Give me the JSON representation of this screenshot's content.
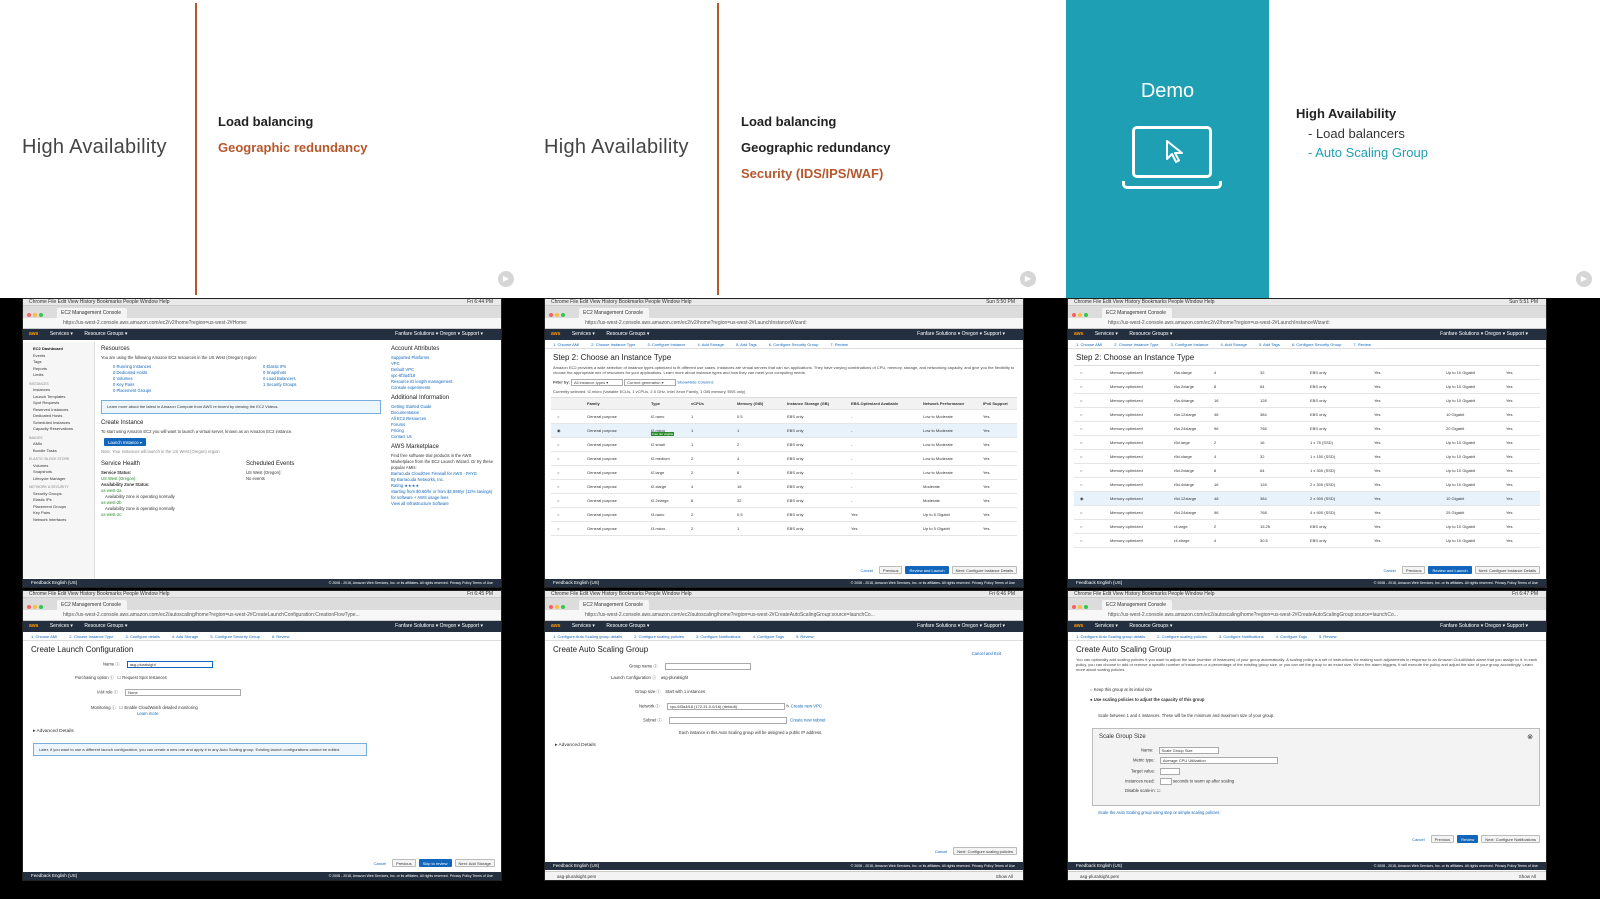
{
  "slides": {
    "s1": {
      "title": "High Availability",
      "bullets": [
        "Load balancing",
        "Geographic redundancy"
      ]
    },
    "s2": {
      "title": "High Availability",
      "bullets": [
        "Load balancing",
        "Geographic redundancy",
        "Security (IDS/IPS/WAF)"
      ]
    },
    "s3": {
      "demo_label": "Demo",
      "title": "High Availability",
      "items": [
        "- Load balancers",
        "- Auto Scaling Group"
      ]
    }
  },
  "colors": {
    "accent_orange": "#b5582d",
    "demo_teal": "#1f9fb3",
    "aws_nav": "#232f3e",
    "aws_orange": "#ff9900",
    "primary_blue": "#1166bb"
  },
  "browser": {
    "mac_menu": "Chrome  File  Edit  View  History  Bookmarks  People  Window  Help",
    "tab_title": "EC2 Management Console",
    "aws_logo": "aws",
    "nav_services": "Services ▾",
    "nav_resource_groups": "Resource Groups ▾",
    "nav_right": "Fanfare Solutions ▾   Oregon ▾   Support ▾",
    "footer": "Feedback   English (US)",
    "copyright": "© 2008 - 2018, Amazon Web Services, Inc. or its affiliates. All rights reserved.   Privacy Policy   Terms of Use"
  },
  "shot1": {
    "time": "Fri 6:44 PM",
    "url": "https://us-west-2.console.aws.amazon.com/ec2/v2/home?region=us-west-2#Home:",
    "sidebar": [
      "EC2 Dashboard",
      "Events",
      "Tags",
      "Reports",
      "Limits",
      "INSTANCES",
      "Instances",
      "Launch Templates",
      "Spot Requests",
      "Reserved Instances",
      "Dedicated Hosts",
      "Scheduled Instances",
      "Capacity Reservations",
      "IMAGES",
      "AMIs",
      "Bundle Tasks",
      "ELASTIC BLOCK STORE",
      "Volumes",
      "Snapshots",
      "Lifecycle Manager",
      "NETWORK & SECURITY",
      "Security Groups",
      "Elastic IPs",
      "Placement Groups",
      "Key Pairs",
      "Network Interfaces"
    ],
    "resources_title": "Resources",
    "resources_intro": "You are using the following Amazon EC2 resources in the US West (Oregon) region:",
    "resources_left": [
      "0 Running Instances",
      "0 Dedicated Hosts",
      "0 Volumes",
      "0 Key Pairs",
      "0 Placement Groups"
    ],
    "resources_right": [
      "0 Elastic IPs",
      "0 Snapshots",
      "0 Load Balancers",
      "1 Security Groups"
    ],
    "info_banner": "Learn more about the latest in Amazon Compute from AWS re:Invent by viewing the EC2 Videos.",
    "create_instance_title": "Create Instance",
    "create_instance_text": "To start using Amazon EC2 you will want to launch a virtual server, known as an Amazon EC2 instance.",
    "launch_button": "Launch Instance ▾",
    "launch_note": "Note: Your instances will launch in the US West (Oregon) region",
    "service_health_title": "Service Health",
    "service_status_label": "Service Status:",
    "service_status_value": "US West (Oregon):",
    "az_status_label": "Availability Zone Status:",
    "az_items": [
      "us-west-2a",
      "Availability zone is operating normally",
      "us-west-2b",
      "Availability zone is operating normally",
      "us-west-2c"
    ],
    "scheduled_title": "Scheduled Events",
    "scheduled_region": "US West (Oregon):",
    "scheduled_value": "No events",
    "account_title": "Account Attributes",
    "account_items": [
      "Supported Platforms",
      "VPC",
      "Default VPC",
      "vpc-6f3a4f18",
      "Resource ID length management",
      "Console experiments"
    ],
    "additional_title": "Additional Information",
    "additional_items": [
      "Getting Started Guide",
      "Documentation",
      "All EC2 Resources",
      "Forums",
      "Pricing",
      "Contact Us"
    ],
    "marketplace_title": "AWS Marketplace",
    "marketplace_text": "Find free software trial products in the AWS Marketplace from the EC2 Launch Wizard. Or try these popular AMIs:",
    "marketplace_items": [
      "Barracuda CloudGen Firewall for AWS - PAYG",
      "By Barracuda Networks, Inc.",
      "Rating ★★★★",
      "Starting from $0.60/hr or from $4,599/yr (12% savings) for software + AWS usage fees",
      "View all Infrastructure Software"
    ]
  },
  "shot2": {
    "time": "Sun 5:50 PM",
    "url": "https://us-west-2.console.aws.amazon.com/ec2/v2/home?region=us-west-2#LaunchInstanceWizard:",
    "steps": [
      "1. Choose AMI",
      "2. Choose Instance Type",
      "3. Configure Instance",
      "4. Add Storage",
      "5. Add Tags",
      "6. Configure Security Group",
      "7. Review"
    ],
    "title": "Step 2: Choose an Instance Type",
    "description": "Amazon EC2 provides a wide selection of instance types optimized to fit different use cases. Instances are virtual servers that can run applications. They have varying combinations of CPU, memory, storage, and networking capacity, and give you the flexibility to choose the appropriate mix of resources for your applications. Learn more about instance types and how they can meet your computing needs.",
    "filter_label": "Filter by:",
    "filter_value": "All instance types ▾",
    "generation_value": "Current generation ▾",
    "show_hide": "Show/Hide Columns",
    "currently_selected": "Currently selected: t2.micro (Variable ECUs, 1 vCPUs, 2.5 GHz, Intel Xeon Family, 1 GiB memory, EBS only)",
    "columns": [
      "Family",
      "Type",
      "vCPUs",
      "Memory (GiB)",
      "Instance Storage (GB)",
      "EBS-Optimized Available",
      "Network Performance",
      "IPv6 Support"
    ],
    "rows": [
      [
        "General purpose",
        "t2.nano",
        "1",
        "0.5",
        "EBS only",
        "-",
        "Low to Moderate",
        "Yes"
      ],
      [
        "General purpose",
        "t2.micro",
        "1",
        "1",
        "EBS only",
        "-",
        "Low to Moderate",
        "Yes"
      ],
      [
        "General purpose",
        "t2.small",
        "1",
        "2",
        "EBS only",
        "-",
        "Low to Moderate",
        "Yes"
      ],
      [
        "General purpose",
        "t2.medium",
        "2",
        "4",
        "EBS only",
        "-",
        "Low to Moderate",
        "Yes"
      ],
      [
        "General purpose",
        "t2.large",
        "2",
        "8",
        "EBS only",
        "-",
        "Low to Moderate",
        "Yes"
      ],
      [
        "General purpose",
        "t2.xlarge",
        "4",
        "16",
        "EBS only",
        "-",
        "Moderate",
        "Yes"
      ],
      [
        "General purpose",
        "t2.2xlarge",
        "8",
        "32",
        "EBS only",
        "-",
        "Moderate",
        "Yes"
      ],
      [
        "General purpose",
        "t3.nano",
        "2",
        "0.5",
        "EBS only",
        "Yes",
        "Up to 5 Gigabit",
        "Yes"
      ],
      [
        "General purpose",
        "t3.micro",
        "2",
        "1",
        "EBS only",
        "Yes",
        "Up to 5 Gigabit",
        "Yes"
      ]
    ],
    "free_tier_badge": "Free tier eligible",
    "buttons": [
      "Cancel",
      "Previous",
      "Review and Launch",
      "Next: Configure Instance Details"
    ]
  },
  "shot3": {
    "time": "Sun 5:51 PM",
    "title": "Step 2: Choose an Instance Type",
    "rows": [
      [
        "Memory optimized",
        "r5a.xlarge",
        "4",
        "32",
        "EBS only",
        "Yes",
        "Up to 10 Gigabit",
        "Yes"
      ],
      [
        "Memory optimized",
        "r5a.2xlarge",
        "8",
        "64",
        "EBS only",
        "Yes",
        "Up to 10 Gigabit",
        "Yes"
      ],
      [
        "Memory optimized",
        "r5a.4xlarge",
        "16",
        "128",
        "EBS only",
        "Yes",
        "Up to 10 Gigabit",
        "Yes"
      ],
      [
        "Memory optimized",
        "r5a.12xlarge",
        "48",
        "384",
        "EBS only",
        "Yes",
        "10 Gigabit",
        "Yes"
      ],
      [
        "Memory optimized",
        "r5a.24xlarge",
        "96",
        "768",
        "EBS only",
        "Yes",
        "20 Gigabit",
        "Yes"
      ],
      [
        "Memory optimized",
        "r5d.large",
        "2",
        "16",
        "1 x 75 (SSD)",
        "Yes",
        "Up to 10 Gigabit",
        "Yes"
      ],
      [
        "Memory optimized",
        "r5d.xlarge",
        "4",
        "32",
        "1 x 150 (SSD)",
        "Yes",
        "Up to 10 Gigabit",
        "Yes"
      ],
      [
        "Memory optimized",
        "r5d.2xlarge",
        "8",
        "64",
        "1 x 300 (SSD)",
        "Yes",
        "Up to 10 Gigabit",
        "Yes"
      ],
      [
        "Memory optimized",
        "r5d.4xlarge",
        "16",
        "128",
        "2 x 300 (SSD)",
        "Yes",
        "Up to 10 Gigabit",
        "Yes"
      ],
      [
        "Memory optimized",
        "r5d.12xlarge",
        "48",
        "384",
        "2 x 900 (SSD)",
        "Yes",
        "10 Gigabit",
        "Yes"
      ],
      [
        "Memory optimized",
        "r5d.24xlarge",
        "96",
        "768",
        "4 x 900 (SSD)",
        "Yes",
        "25 Gigabit",
        "Yes"
      ],
      [
        "Memory optimized",
        "r4.large",
        "2",
        "15.25",
        "EBS only",
        "Yes",
        "Up to 10 Gigabit",
        "Yes"
      ],
      [
        "Memory optimized",
        "r4.xlarge",
        "4",
        "30.5",
        "EBS only",
        "Yes",
        "Up to 10 Gigabit",
        "Yes"
      ]
    ],
    "buttons": [
      "Cancel",
      "Previous",
      "Review and Launch",
      "Next: Configure Instance Details"
    ]
  },
  "shot4": {
    "time": "Fri 6:45 PM",
    "url": "https://us-west-2.console.aws.amazon.com/ec2/autoscaling/home?region=us-west-2#CreateLaunchConfiguration:CreationFlowType...",
    "steps": [
      "1. Choose AMI",
      "2. Choose Instance Type",
      "3. Configure details",
      "4. Add Storage",
      "5. Configure Security Group",
      "6. Review"
    ],
    "title": "Create Launch Configuration",
    "name_label": "Name",
    "name_value": "asg-pluralsight",
    "purchasing_label": "Purchasing option",
    "purchasing_value": "Request Spot Instances",
    "iam_label": "IAM role",
    "iam_value": "None",
    "monitoring_label": "Monitoring",
    "monitoring_value": "Enable CloudWatch detailed monitoring",
    "learn_more": "Learn more",
    "advanced": "▸ Advanced Details",
    "info_note": "Later, if you want to use a different launch configuration, you can create a new one and apply it to any Auto Scaling group. Existing launch configurations cannot be edited.",
    "buttons": [
      "Cancel",
      "Previous",
      "Skip to review",
      "Next: Add Storage"
    ]
  },
  "shot5": {
    "time": "Fri 6:46 PM",
    "url": "https://us-west-2.console.aws.amazon.com/ec2/autoscaling/home?region=us-west-2#CreateAutoScalingGroup:source=launchCo...",
    "steps": [
      "1. Configure Auto Scaling group details",
      "2. Configure scaling policies",
      "3. Configure Notifications",
      "4. Configure Tags",
      "5. Review"
    ],
    "title": "Create Auto Scaling Group",
    "cancel_exit": "Cancel and Exit",
    "group_name_label": "Group name",
    "launch_config_label": "Launch Configuration",
    "launch_config_value": "asg-pluralsight",
    "group_size_label": "Group size",
    "group_size_value": "Start with  1  instances",
    "network_label": "Network",
    "network_value": "vpc-6f3a4f18 (172.31.0.0/16) (default)",
    "create_vpc": "Create new VPC",
    "subnet_label": "Subnet",
    "create_subnet": "Create new subnet",
    "subnet_note": "Each instance in this Auto Scaling group will be assigned a public IP address.",
    "advanced": "▸ Advanced Details",
    "download_file": "asg-pluralsight.pem",
    "show_all": "Show All",
    "buttons": [
      "Cancel",
      "Next: Configure scaling policies"
    ]
  },
  "shot6": {
    "time": "Fri 6:47 PM",
    "url": "https://us-west-2.console.aws.amazon.com/ec2/autoscaling/home?region=us-west-2#CreateAutoScalingGroup:source=launchCo...",
    "steps": [
      "1. Configure Auto Scaling group details",
      "2. Configure scaling policies",
      "3. Configure Notifications",
      "4. Configure Tags",
      "5. Review"
    ],
    "title": "Create Auto Scaling Group",
    "description": "You can optionally add scaling policies if you want to adjust the size (number of instances) of your group automatically. A scaling policy is a set of instructions for making such adjustments in response to an Amazon CloudWatch alarm that you assign to it. In each policy, you can choose to add or remove a specific number of instances or a percentage of the existing group size, or you can set the group to an exact size. When the alarm triggers, it will execute the policy and adjust the size of your group accordingly. Learn more about scaling policies.",
    "option_keep": "Keep this group at its initial size",
    "option_use": "Use scaling policies to adjust the capacity of this group",
    "scale_between": "Scale between  1  and  4  instances. These will be the minimum and maximum size of your group.",
    "modal_title": "Scale Group Size",
    "modal_name_label": "Name:",
    "modal_name_value": "Scale Group Size",
    "metric_label": "Metric type:",
    "metric_value": "Average CPU Utilization",
    "target_label": "Target value:",
    "warmup_label": "Instances need:",
    "warmup_value": "seconds to warm up after scaling",
    "disable_label": "Disable scale-in:",
    "steps_link": "Scale the Auto Scaling group using step or simple scaling policies",
    "download_file": "asg-pluralsight.pem",
    "show_all": "Show All",
    "buttons": [
      "Cancel",
      "Previous",
      "Review",
      "Next: Configure Notifications"
    ]
  }
}
